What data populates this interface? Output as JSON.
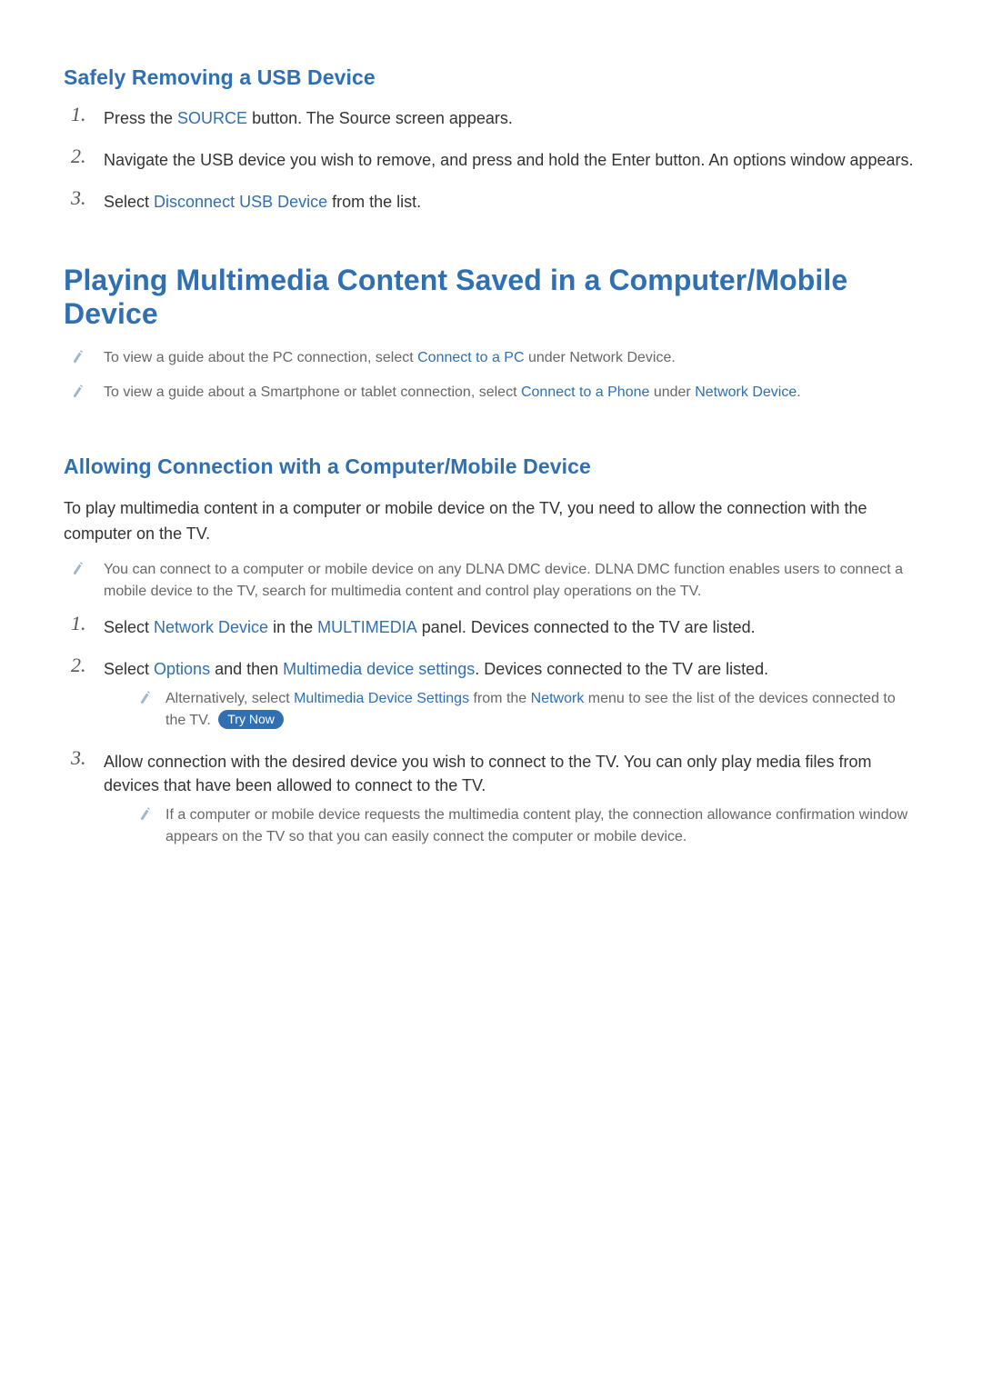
{
  "colors": {
    "accent": "#2f6fb2",
    "body": "#333333",
    "muted": "#676767"
  },
  "section1": {
    "title": "Safely Removing a USB Device",
    "steps": [
      {
        "num": "1.",
        "parts": [
          {
            "t": "Press the "
          },
          {
            "t": "SOURCE",
            "accent": true
          },
          {
            "t": " button. The Source screen appears."
          }
        ]
      },
      {
        "num": "2.",
        "parts": [
          {
            "t": "Navigate the USB device you wish to remove, and press and hold the Enter button. An options window appears."
          }
        ]
      },
      {
        "num": "3.",
        "parts": [
          {
            "t": "Select "
          },
          {
            "t": "Disconnect USB Device",
            "accent": true
          },
          {
            "t": " from the list."
          }
        ]
      }
    ]
  },
  "section2": {
    "title": "Playing Multimedia Content Saved in a Computer/Mobile Device",
    "notes": [
      {
        "parts": [
          {
            "t": "To view a guide about the PC connection, select "
          },
          {
            "t": "Connect to a PC",
            "accent": true
          },
          {
            "t": " under Network Device."
          }
        ]
      },
      {
        "parts": [
          {
            "t": "To view a guide about a Smartphone or tablet connection, select "
          },
          {
            "t": "Connect to a Phone",
            "accent": true
          },
          {
            "t": " under "
          },
          {
            "t": "Network Device",
            "accent": true
          },
          {
            "t": "."
          }
        ]
      }
    ]
  },
  "section3": {
    "title": "Allowing Connection with a Computer/Mobile Device",
    "intro": "To play multimedia content in a computer or mobile device on the TV, you need to allow the connection with the computer on the TV.",
    "note_top": {
      "parts": [
        {
          "t": "You can connect to a computer or mobile device on any DLNA DMC device. DLNA DMC function enables users to connect a mobile device to the TV, search for multimedia content and control play operations on the TV."
        }
      ]
    },
    "steps": [
      {
        "num": "1.",
        "parts": [
          {
            "t": "Select "
          },
          {
            "t": "Network Device",
            "accent": true
          },
          {
            "t": " in the "
          },
          {
            "t": "MULTIMEDIA",
            "accent": true
          },
          {
            "t": " panel. Devices connected to the TV are listed."
          }
        ]
      },
      {
        "num": "2.",
        "parts": [
          {
            "t": "Select "
          },
          {
            "t": "Options",
            "accent": true
          },
          {
            "t": " and then "
          },
          {
            "t": "Multimedia device settings",
            "accent": true
          },
          {
            "t": ". Devices connected to the TV are listed."
          }
        ],
        "subnote": {
          "parts": [
            {
              "t": "Alternatively, select "
            },
            {
              "t": "Multimedia Device Settings",
              "accent": true
            },
            {
              "t": " from the "
            },
            {
              "t": "Network",
              "accent": true
            },
            {
              "t": " menu to see the list of the devices connected to the TV. "
            }
          ],
          "try_now": "Try Now"
        }
      },
      {
        "num": "3.",
        "parts": [
          {
            "t": "Allow connection with the desired device you wish to connect to the TV. You can only play media files from devices that have been allowed to connect to the TV."
          }
        ],
        "subnote": {
          "parts": [
            {
              "t": "If a computer or mobile device requests the multimedia content play, the connection allowance confirmation window appears on the TV so that you can easily connect the computer or mobile device."
            }
          ]
        }
      }
    ]
  }
}
